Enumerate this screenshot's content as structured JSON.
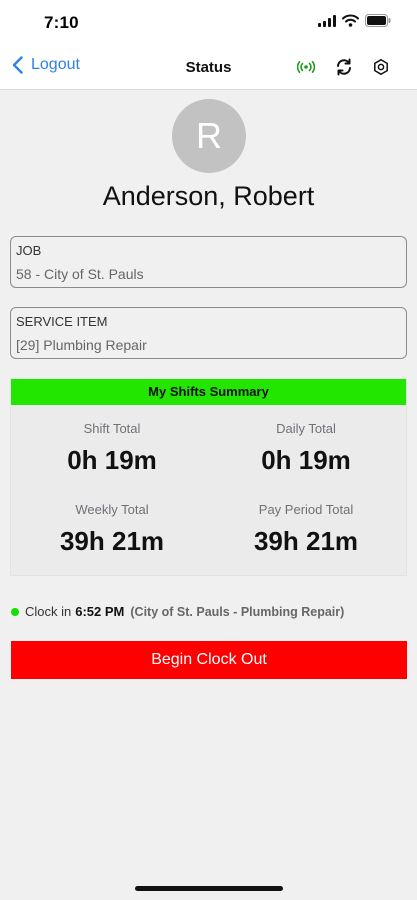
{
  "status_bar": {
    "time": "7:10"
  },
  "nav": {
    "back_label": "Logout",
    "title": "Status",
    "icons": [
      "signal-icon",
      "refresh-icon",
      "gear-icon"
    ]
  },
  "user": {
    "initial": "R",
    "name": "Anderson, Robert"
  },
  "job": {
    "label": "JOB",
    "value": "58 - City of St. Pauls"
  },
  "service_item": {
    "label": "SERVICE ITEM",
    "value": "[29] Plumbing Repair"
  },
  "summary": {
    "title": "My Shifts Summary",
    "stats": [
      {
        "label": "Shift Total",
        "value": "0h 19m"
      },
      {
        "label": "Daily Total",
        "value": "0h 19m"
      },
      {
        "label": "Weekly Total",
        "value": "39h 21m"
      },
      {
        "label": "Pay Period Total",
        "value": "39h 21m"
      }
    ],
    "header_color": "#22e600"
  },
  "clock": {
    "prefix": "Clock in",
    "time": "6:52 PM",
    "detail": "(City of St. Pauls - Plumbing Repair)",
    "status_color": "#12e000"
  },
  "actions": {
    "clock_out_label": "Begin Clock Out",
    "button_color": "#ff0000"
  },
  "colors": {
    "accent": "#2f80ed"
  }
}
